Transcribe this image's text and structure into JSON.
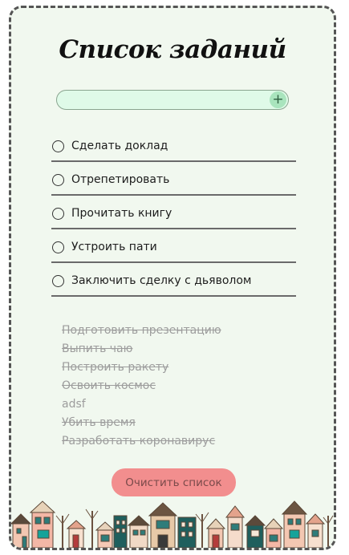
{
  "app": {
    "title": "Список заданий"
  },
  "input": {
    "value": "",
    "placeholder": "",
    "add_label": "+"
  },
  "tasks": [
    {
      "label": "Сделать доклад"
    },
    {
      "label": "Отрепетировать"
    },
    {
      "label": "Прочитать книгу"
    },
    {
      "label": "Устроить пати"
    },
    {
      "label": "Заключить сделку с дьяволом"
    }
  ],
  "completed": [
    {
      "label": "Подготовить презентацию",
      "struck": true
    },
    {
      "label": "Выпить чаю",
      "struck": true
    },
    {
      "label": "Построить ракету",
      "struck": true
    },
    {
      "label": "Освоить космос",
      "struck": true
    },
    {
      "label": "adsf",
      "struck": false
    },
    {
      "label": "Убить время",
      "struck": true
    },
    {
      "label": "Разработать коронавирус",
      "struck": true
    }
  ],
  "clear": {
    "label": "Очистить список"
  },
  "colors": {
    "background": "#f1f8ef",
    "input_bg": "#dffae8",
    "add_button": "#a9e4bd",
    "clear_button": "#f28e8e",
    "completed_text": "#9d9d9d"
  },
  "icons": {
    "add": "plus-icon",
    "task_toggle": "circle-checkbox-icon",
    "footer": "houses-illustration"
  }
}
